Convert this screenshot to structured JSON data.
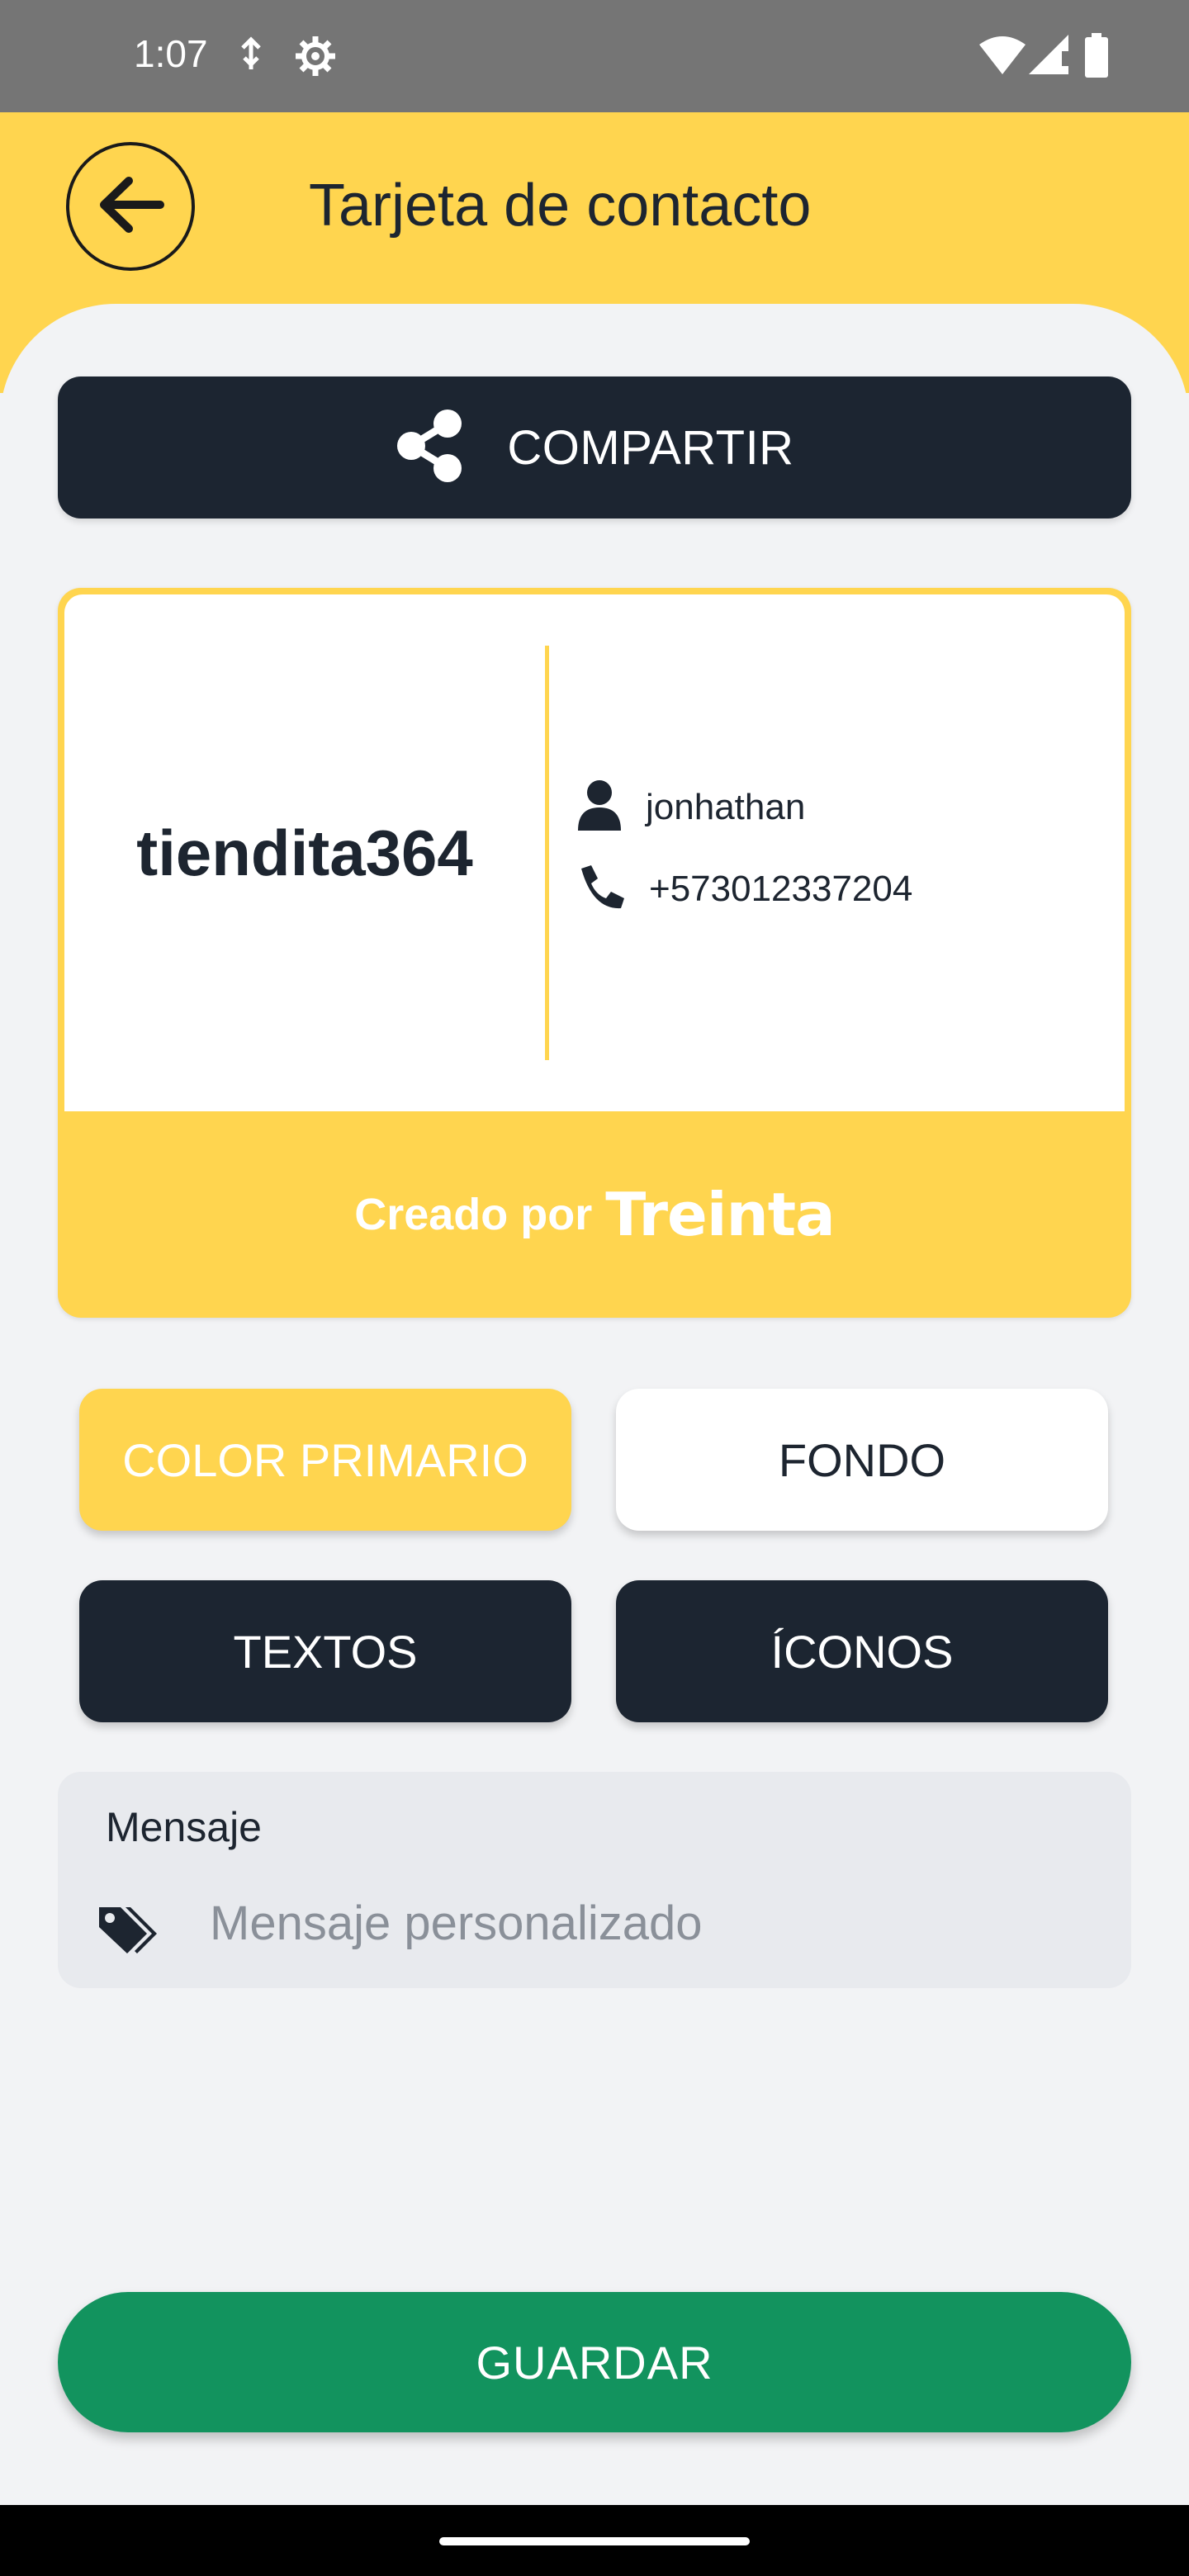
{
  "status_bar": {
    "time": "1:07",
    "icons": [
      "usb-debug-icon",
      "settings-icon",
      "wifi-icon",
      "signal-icon",
      "battery-icon"
    ]
  },
  "header": {
    "title": "Tarjeta de contacto",
    "back_icon": "arrow-left-icon"
  },
  "share_button": {
    "label": "COMPARTIR",
    "icon": "share-icon"
  },
  "card": {
    "store_name": "tiendita364",
    "contact_name": "jonhathan",
    "contact_phone": "+573012337204",
    "footer_prefix": "Creado por",
    "footer_brand": "Treinta"
  },
  "options": {
    "primary_color": "COLOR PRIMARIO",
    "background": "FONDO",
    "texts": "TEXTOS",
    "icons": "ÍCONOS"
  },
  "message": {
    "label": "Mensaje",
    "placeholder": "Mensaje personalizado",
    "value": ""
  },
  "save_button": {
    "label": "GUARDAR"
  },
  "colors": {
    "accent": "#ffd54f",
    "dark": "#1c2531",
    "save": "#12935e",
    "background": "#f2f3f5"
  }
}
